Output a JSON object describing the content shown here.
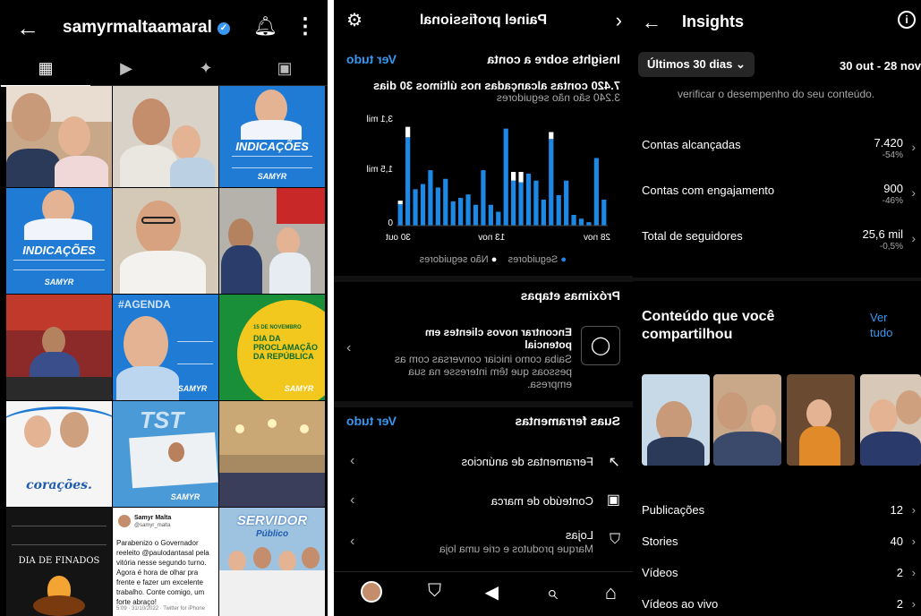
{
  "profile": {
    "username": "samyrmaltaamaral",
    "tiles": {
      "indicacoes_1": "INDICAÇÕES",
      "indicacoes_2": "INDICAÇÕES",
      "brand": "SAMYR",
      "agenda": "#AGENDA",
      "proclamacao_date": "15 DE NOVEMBRO",
      "proclamacao": "DIA DA PROCLAMAÇÃO DA REPÚBLICA",
      "coracoes": "corações.",
      "finados": "DIA DE FINADOS",
      "servidor": "SERVIDOR",
      "servidor_sub": "Público",
      "tweet_name": "Samyr Malta",
      "tweet_handle": "@samyr_malta",
      "tweet_text": "Parabenizo o Governador reeleito @paulodantasal pela vitória nesse segundo turno. Agora é hora de olhar pra frente e fazer um excelente trabalho. Conte comigo, um forte abraço!",
      "tweet_footer": "5:09 · 31/10/2022 · Twitter for iPhone"
    }
  },
  "painel": {
    "title": "Painel profissional",
    "insights_title": "Insights sobre a conta",
    "ver_tudo": "Ver tudo",
    "summary": "7.420 contas alcançadas nos últimos 30 dias",
    "summary_sub": "3.240 são não seguidores",
    "legend_followers": "Seguidores",
    "legend_nonfollowers": "Não seguidores",
    "proximas_title": "Próximas etapas",
    "proximas_card_title": "Encontrar novos clientes em potencial",
    "proximas_card_text": "Saiba como iniciar conversas com as pessoas que têm interesse na sua empresa.",
    "ferramentas_title": "Suas ferramentas",
    "ferramentas_ver_tudo": "Ver tudo",
    "tool_ads": "Ferramentas de anúncios",
    "tool_brand": "Conteúdo de marca",
    "tool_shops": "Lojas",
    "tool_shops_sub": "Marque produtos e crie uma loja"
  },
  "chart_data": {
    "type": "bar",
    "x_tick_labels": [
      "28 nov",
      "13 nov",
      "30 out"
    ],
    "y_tick_labels": [
      "3,1 mil",
      "1,5 mil",
      "0"
    ],
    "ylim": [
      0,
      3100
    ],
    "series": [
      {
        "name": "Seguidores",
        "color": "#1e88e5",
        "values": [
          750,
          1950,
          100,
          200,
          310,
          1300,
          880,
          2500,
          750,
          1300,
          1500,
          1250,
          1300,
          2800,
          400,
          600,
          1600,
          600,
          900,
          800,
          700,
          1350,
          1100,
          1600,
          1200,
          1050,
          2550,
          620
        ]
      },
      {
        "name": "Não seguidores",
        "color": "#ffffff",
        "values": [
          0,
          0,
          0,
          0,
          0,
          0,
          0,
          200,
          0,
          0,
          0,
          300,
          250,
          0,
          0,
          0,
          0,
          0,
          0,
          0,
          0,
          0,
          0,
          0,
          0,
          0,
          300,
          100
        ]
      }
    ]
  },
  "insights": {
    "title": "Insights",
    "filter": "Últimos 30 dias",
    "range": "30 out - 28 nov",
    "top_text": "verificar o desempenho do seu conteúdo.",
    "metrics": [
      {
        "label": "Contas alcançadas",
        "value": "7.420",
        "pct": "-54%"
      },
      {
        "label": "Contas com engajamento",
        "value": "900",
        "pct": "-46%"
      },
      {
        "label": "Total de seguidores",
        "value": "25,6 mil",
        "pct": "-0,5%"
      }
    ],
    "shared_title": "Conteúdo que você compartilhou",
    "shared_ver_tudo": "Ver tudo",
    "counts": [
      {
        "label": "Publicações",
        "value": "12"
      },
      {
        "label": "Stories",
        "value": "40"
      },
      {
        "label": "Vídeos",
        "value": "2"
      },
      {
        "label": "Vídeos ao vivo",
        "value": "2"
      }
    ]
  }
}
